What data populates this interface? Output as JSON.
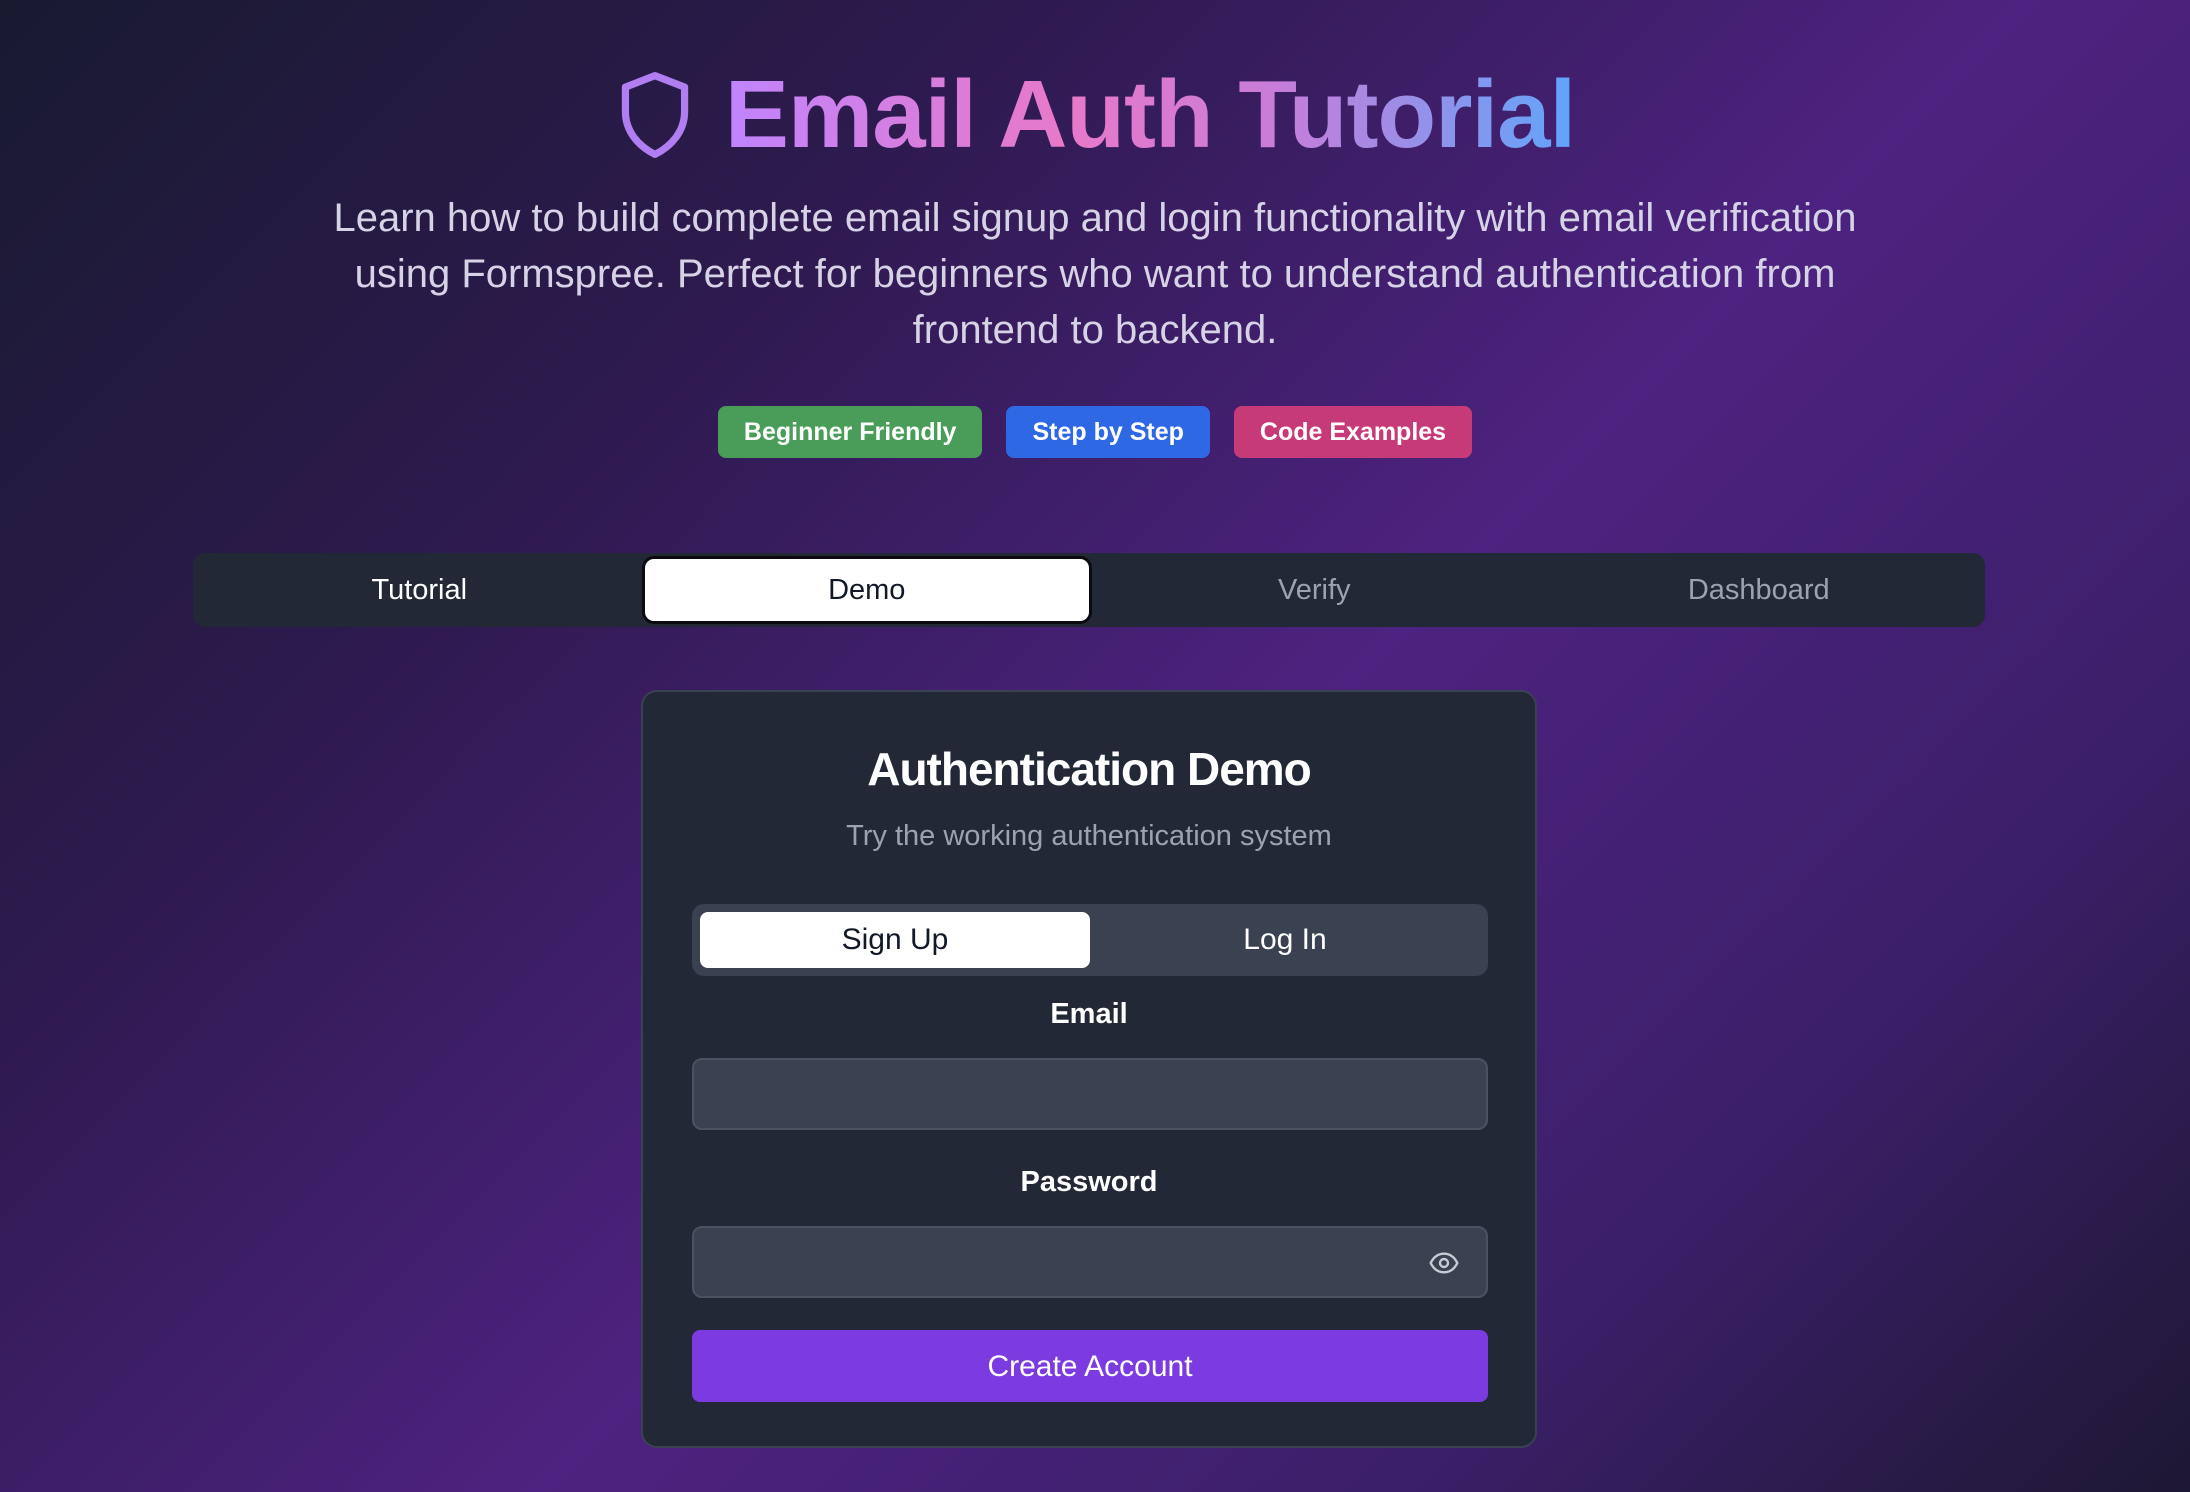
{
  "header": {
    "icon": "shield-icon",
    "title": "Email Auth Tutorial",
    "subtitle": "Learn how to build complete email signup and login functionality with email verification using Formspree. Perfect for beginners who want to understand authentication from frontend to backend."
  },
  "badges": [
    {
      "label": "Beginner Friendly",
      "color": "#4a9d58"
    },
    {
      "label": "Step by Step",
      "color": "#2f68e4"
    },
    {
      "label": "Code Examples",
      "color": "#c73a78"
    }
  ],
  "tabs": [
    {
      "label": "Tutorial",
      "state": "enabled"
    },
    {
      "label": "Demo",
      "state": "active"
    },
    {
      "label": "Verify",
      "state": "disabled"
    },
    {
      "label": "Dashboard",
      "state": "disabled"
    }
  ],
  "demo": {
    "title": "Authentication Demo",
    "subtitle": "Try the working authentication system",
    "toggle": [
      {
        "label": "Sign Up",
        "active": true
      },
      {
        "label": "Log In",
        "active": false
      }
    ],
    "email": {
      "label": "Email",
      "value": "",
      "placeholder": ""
    },
    "password": {
      "label": "Password",
      "value": "",
      "placeholder": "",
      "toggle_icon": "eye-icon"
    },
    "submit_label": "Create Account"
  },
  "colors": {
    "accent": "#7c3be0",
    "card_bg": "#222836",
    "input_bg": "#3a4150"
  }
}
